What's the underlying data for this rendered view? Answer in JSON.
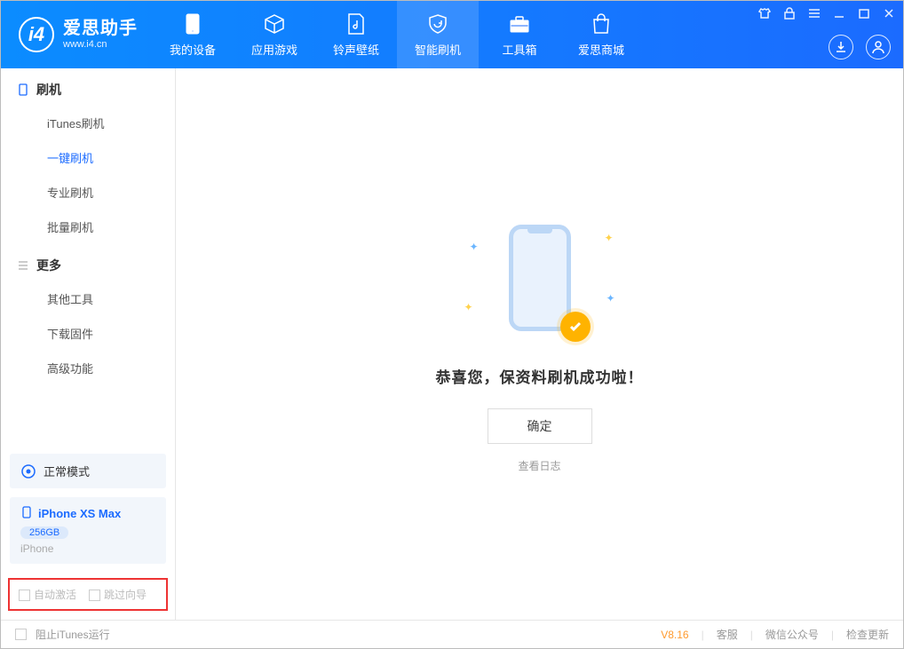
{
  "app": {
    "name": "爱思助手",
    "site": "www.i4.cn"
  },
  "tabs": [
    {
      "label": "我的设备"
    },
    {
      "label": "应用游戏"
    },
    {
      "label": "铃声壁纸"
    },
    {
      "label": "智能刷机"
    },
    {
      "label": "工具箱"
    },
    {
      "label": "爱思商城"
    }
  ],
  "sidebar": {
    "group1": {
      "title": "刷机",
      "items": [
        {
          "label": "iTunes刷机"
        },
        {
          "label": "一键刷机"
        },
        {
          "label": "专业刷机"
        },
        {
          "label": "批量刷机"
        }
      ]
    },
    "group2": {
      "title": "更多",
      "items": [
        {
          "label": "其他工具"
        },
        {
          "label": "下载固件"
        },
        {
          "label": "高级功能"
        }
      ]
    },
    "mode": "正常模式",
    "device": {
      "name": "iPhone XS Max",
      "capacity": "256GB",
      "kind": "iPhone"
    },
    "opts": {
      "a": "自动激活",
      "b": "跳过向导"
    }
  },
  "main": {
    "message": "恭喜您，保资料刷机成功啦！",
    "ok": "确定",
    "log": "查看日志"
  },
  "footer": {
    "block": "阻止iTunes运行",
    "version": "V8.16",
    "svc": "客服",
    "wx": "微信公众号",
    "upd": "检查更新"
  }
}
